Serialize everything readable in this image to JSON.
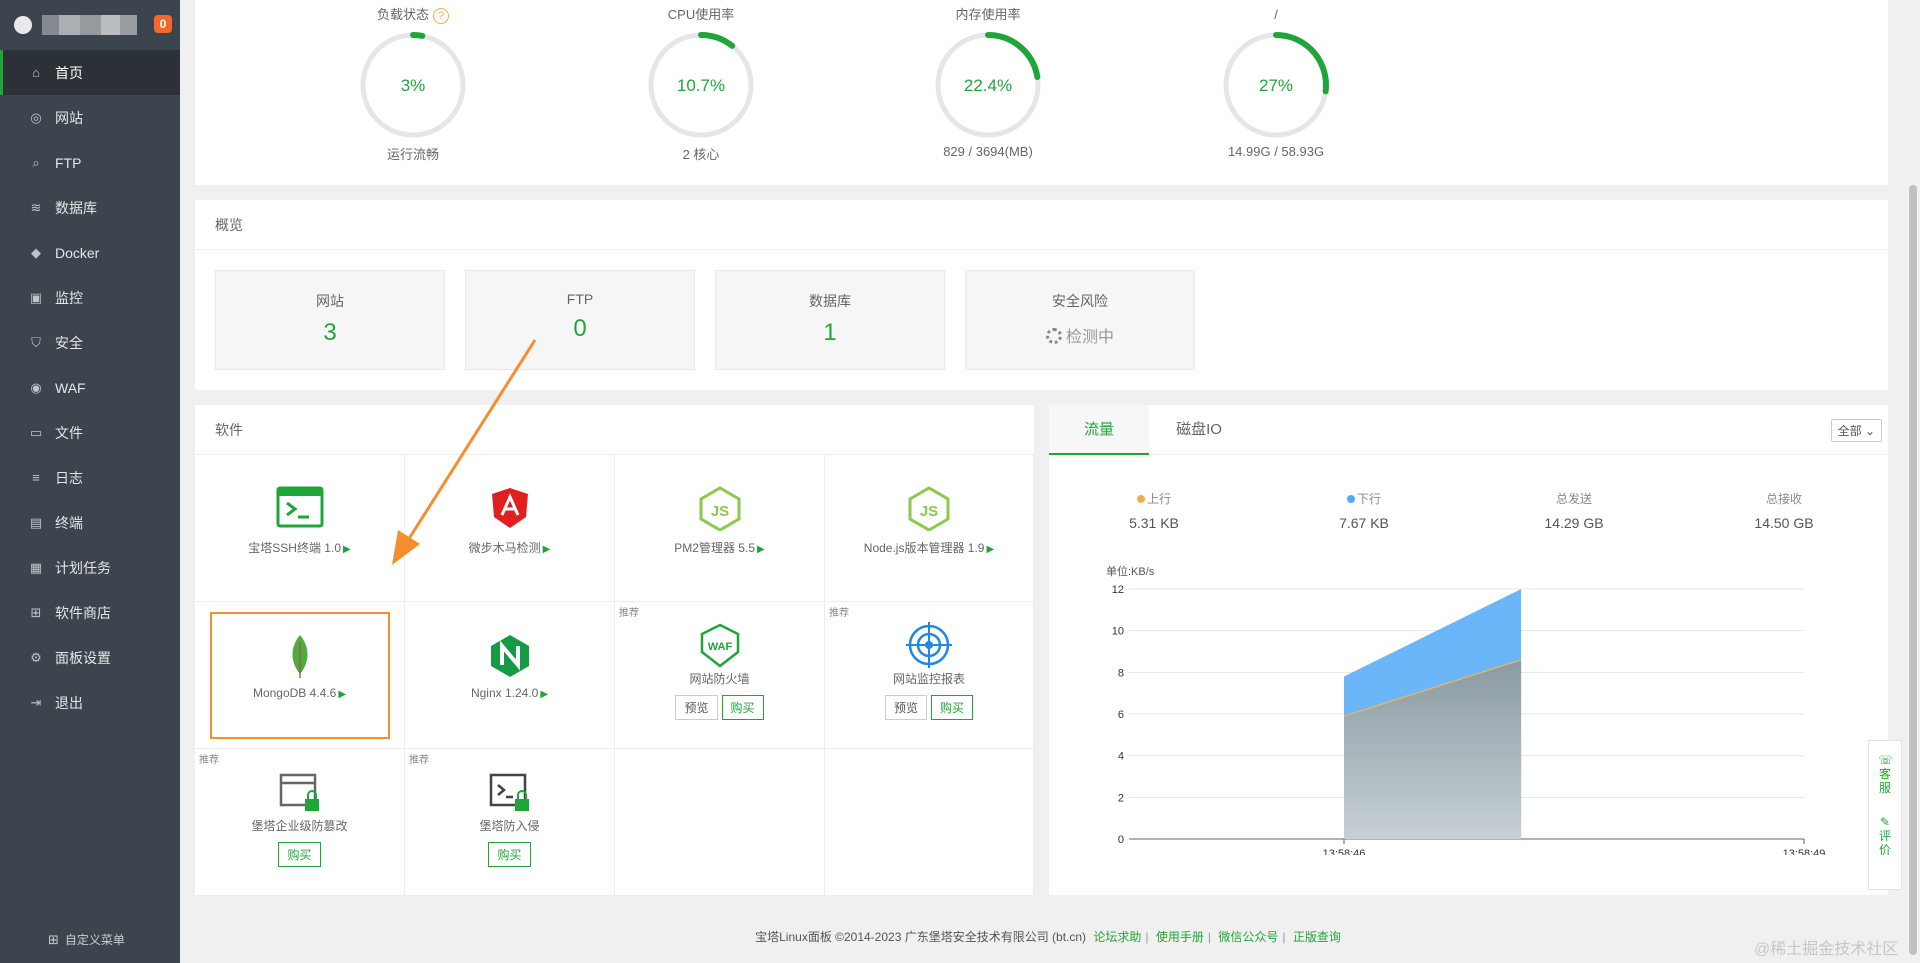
{
  "brand": {
    "badge": "0"
  },
  "sidebar": {
    "items": [
      {
        "label": "首页",
        "icon": "home-icon",
        "glyph": "⌂"
      },
      {
        "label": "网站",
        "icon": "globe-icon",
        "glyph": "◎"
      },
      {
        "label": "FTP",
        "icon": "ftp-icon",
        "glyph": "⌕"
      },
      {
        "label": "数据库",
        "icon": "database-icon",
        "glyph": "≋"
      },
      {
        "label": "Docker",
        "icon": "docker-icon",
        "glyph": "◆"
      },
      {
        "label": "监控",
        "icon": "monitor-icon",
        "glyph": "▣"
      },
      {
        "label": "安全",
        "icon": "shield-icon",
        "glyph": "⛉"
      },
      {
        "label": "WAF",
        "icon": "waf-icon",
        "glyph": "◉"
      },
      {
        "label": "文件",
        "icon": "folder-icon",
        "glyph": "▭"
      },
      {
        "label": "日志",
        "icon": "log-icon",
        "glyph": "≡"
      },
      {
        "label": "终端",
        "icon": "terminal-icon",
        "glyph": "▤"
      },
      {
        "label": "计划任务",
        "icon": "calendar-icon",
        "glyph": "▦"
      },
      {
        "label": "软件商店",
        "icon": "grid-icon",
        "glyph": "⊞"
      },
      {
        "label": "面板设置",
        "icon": "gear-icon",
        "glyph": "⚙"
      },
      {
        "label": "退出",
        "icon": "logout-icon",
        "glyph": "⇥"
      }
    ],
    "custom_menu": "自定义菜单"
  },
  "status": {
    "gauges": [
      {
        "label": "负载状态",
        "value_text": "3%",
        "percent": 3,
        "sub": "运行流畅",
        "help": "?"
      },
      {
        "label": "CPU使用率",
        "value_text": "10.7%",
        "percent": 10.7,
        "sub": "2 核心"
      },
      {
        "label": "内存使用率",
        "value_text": "22.4%",
        "percent": 22.4,
        "sub": "829 / 3694(MB)"
      },
      {
        "label": "/",
        "value_text": "27%",
        "percent": 27,
        "sub": "14.99G / 58.93G"
      }
    ]
  },
  "overview": {
    "title": "概览",
    "cards": [
      {
        "label": "网站",
        "value": "3"
      },
      {
        "label": "FTP",
        "value": "0"
      },
      {
        "label": "数据库",
        "value": "1"
      },
      {
        "label": "安全风险",
        "value": "检测中"
      }
    ]
  },
  "software": {
    "title": "软件",
    "items": [
      {
        "name": "宝塔SSH终端 1.0",
        "icon": "ssh-terminal-icon",
        "tag": "",
        "preview": "",
        "buy": ""
      },
      {
        "name": "微步木马检测",
        "icon": "trojan-detect-icon",
        "tag": "",
        "preview": "",
        "buy": ""
      },
      {
        "name": "PM2管理器 5.5",
        "icon": "pm2-icon",
        "tag": "",
        "preview": "",
        "buy": ""
      },
      {
        "name": "Node.js版本管理器 1.9",
        "icon": "nodejs-icon",
        "tag": "",
        "preview": "",
        "buy": ""
      },
      {
        "name": "MongoDB 4.4.6",
        "icon": "mongodb-icon",
        "tag": "",
        "preview": "",
        "buy": ""
      },
      {
        "name": "Nginx 1.24.0",
        "icon": "nginx-icon",
        "tag": "",
        "preview": "",
        "buy": ""
      },
      {
        "name": "网站防火墙",
        "icon": "waf-firewall-icon",
        "tag": "推荐",
        "preview": "预览",
        "buy": "购买"
      },
      {
        "name": "网站监控报表",
        "icon": "site-monitor-icon",
        "tag": "推荐",
        "preview": "预览",
        "buy": "购买"
      },
      {
        "name": "堡塔企业级防篡改",
        "icon": "tamper-proof-icon",
        "tag": "推荐",
        "preview": "",
        "buy": "购买"
      },
      {
        "name": "堡塔防入侵",
        "icon": "intrusion-icon",
        "tag": "推荐",
        "preview": "",
        "buy": "购买"
      }
    ]
  },
  "traffic": {
    "tabs": [
      "流量",
      "磁盘IO"
    ],
    "select": "全部",
    "stats": [
      {
        "label": "上行",
        "value": "5.31 KB",
        "dot": "#f0ad4e"
      },
      {
        "label": "下行",
        "value": "7.67 KB",
        "dot": "#52a9ff"
      },
      {
        "label": "总发送",
        "value": "14.29 GB",
        "dot": ""
      },
      {
        "label": "总接收",
        "value": "14.50 GB",
        "dot": ""
      }
    ],
    "chart_data": {
      "type": "area",
      "ylabel": "单位:KB/s",
      "y_ticks": [
        "0",
        "2",
        "4",
        "6",
        "8",
        "10",
        "12"
      ],
      "y_tick_values": [
        0,
        2,
        4,
        6,
        8,
        10,
        12
      ],
      "ylim": [
        0,
        12
      ],
      "x_ticks": [
        "13:58:46",
        "13:58:49"
      ],
      "series": [
        {
          "name": "上行",
          "color": "#8a9aa3",
          "x_frac": [
            0,
            0.55
          ],
          "values": [
            5.9,
            8.6
          ]
        },
        {
          "name": "下行",
          "color": "#5aaef8",
          "x_frac": [
            0,
            0.55
          ],
          "values": [
            7.8,
            12
          ]
        }
      ],
      "grid": true
    }
  },
  "footer": {
    "copyright": "宝塔Linux面板 ©2014-2023 广东堡塔安全技术有限公司 (bt.cn)",
    "links": [
      "论坛求助",
      "使用手册",
      "微信公众号",
      "正版查询"
    ]
  },
  "float_bar": [
    "客服",
    "评价"
  ],
  "watermark": "@稀土掘金技术社区",
  "colors": {
    "accent": "#20a53a",
    "sidebar": "#3c444d",
    "highlight": "#f68d2e"
  }
}
